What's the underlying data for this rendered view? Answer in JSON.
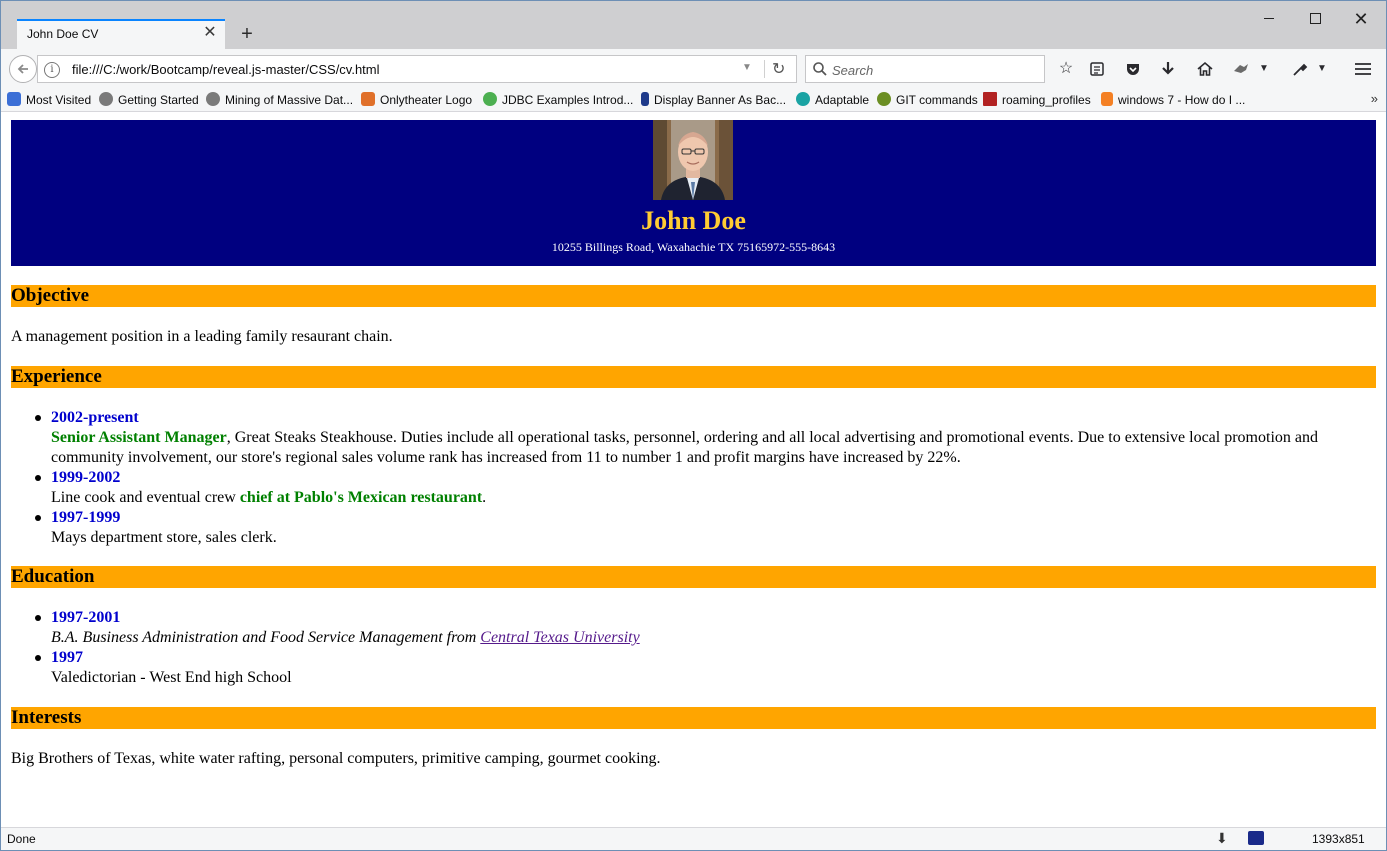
{
  "browser": {
    "tab_title": "John Doe CV",
    "tab_close": "✕",
    "new_tab": "+",
    "url": "file:///C:/work/Bootcamp/reveal.js-master/CSS/cv.html",
    "search_placeholder": "Search",
    "window_close": "✕"
  },
  "bookmarks": [
    {
      "label": "Most Visited",
      "icon_color": "#3b6fd6"
    },
    {
      "label": "Getting Started",
      "icon_color": "#7a7a7a"
    },
    {
      "label": "Mining of Massive Dat...",
      "icon_color": "#7a7a7a"
    },
    {
      "label": "Onlytheater Logo",
      "icon_color": "#e0702a"
    },
    {
      "label": "JDBC Examples Introd...",
      "icon_color": "#4caf50"
    },
    {
      "label": "Display Banner As Bac...",
      "icon_color": "#1e3a8a"
    },
    {
      "label": "Adaptable",
      "icon_color": "#1aa3a3"
    },
    {
      "label": "GIT commands",
      "icon_color": "#6b8e23"
    },
    {
      "label": "roaming_profiles",
      "icon_color": "#b22222"
    },
    {
      "label": "windows 7 - How do I ...",
      "icon_color": "#f48024"
    }
  ],
  "cv": {
    "name": "John Doe",
    "address": "10255 Billings Road, Waxahachie TX 75165972-555-8643",
    "objective": {
      "heading": "Objective",
      "text": "A management position in a leading family resaurant chain."
    },
    "experience": {
      "heading": "Experience",
      "items": [
        {
          "date": "2002-present",
          "role": "Senior Assistant Manager",
          "line1": ", Great Steaks Steakhouse. Duties include all operational tasks, personnel, ordering and all local advertising and promotional events. Due to extensive local promotion and",
          "line2": "community involvement, our store's regional sales volume rank has increased from 11 to number 1 and profit margins have increased by 22%."
        },
        {
          "date": "1999-2002",
          "text_before": "Line cook and eventual crew ",
          "highlight": "chief at Pablo's Mexican restaurant",
          "text_after": "."
        },
        {
          "date": "1997-1999",
          "text": "Mays department store, sales clerk."
        }
      ]
    },
    "education": {
      "heading": "Education",
      "items": [
        {
          "date": "1997-2001",
          "text": "B.A. Business Administration and Food Service Management from ",
          "link": "Central Texas University"
        },
        {
          "date": "1997",
          "text": "Valedictorian - West End high School"
        }
      ]
    },
    "interests": {
      "heading": "Interests",
      "text": "Big Brothers of Texas, white water rafting, personal computers, primitive camping, gourmet cooking."
    }
  },
  "status": {
    "text": "Done",
    "size": "1393x851"
  },
  "colors": {
    "header_bg": "#000080",
    "name_color": "#ffcc33",
    "section_bg": "#ffa500",
    "date_color": "#0000cd",
    "highlight_color": "#008000",
    "visited_link": "#551a8b",
    "tab_accent": "#0a84ff"
  },
  "icons": {
    "back": "arrow-left-icon",
    "info": "info-icon",
    "reload": "reload-icon",
    "search": "search-icon",
    "bookmark_star": "star-icon",
    "library": "library-icon",
    "pocket": "pocket-icon",
    "downloads": "download-icon",
    "home": "home-icon",
    "menu": "hamburger-menu-icon"
  }
}
